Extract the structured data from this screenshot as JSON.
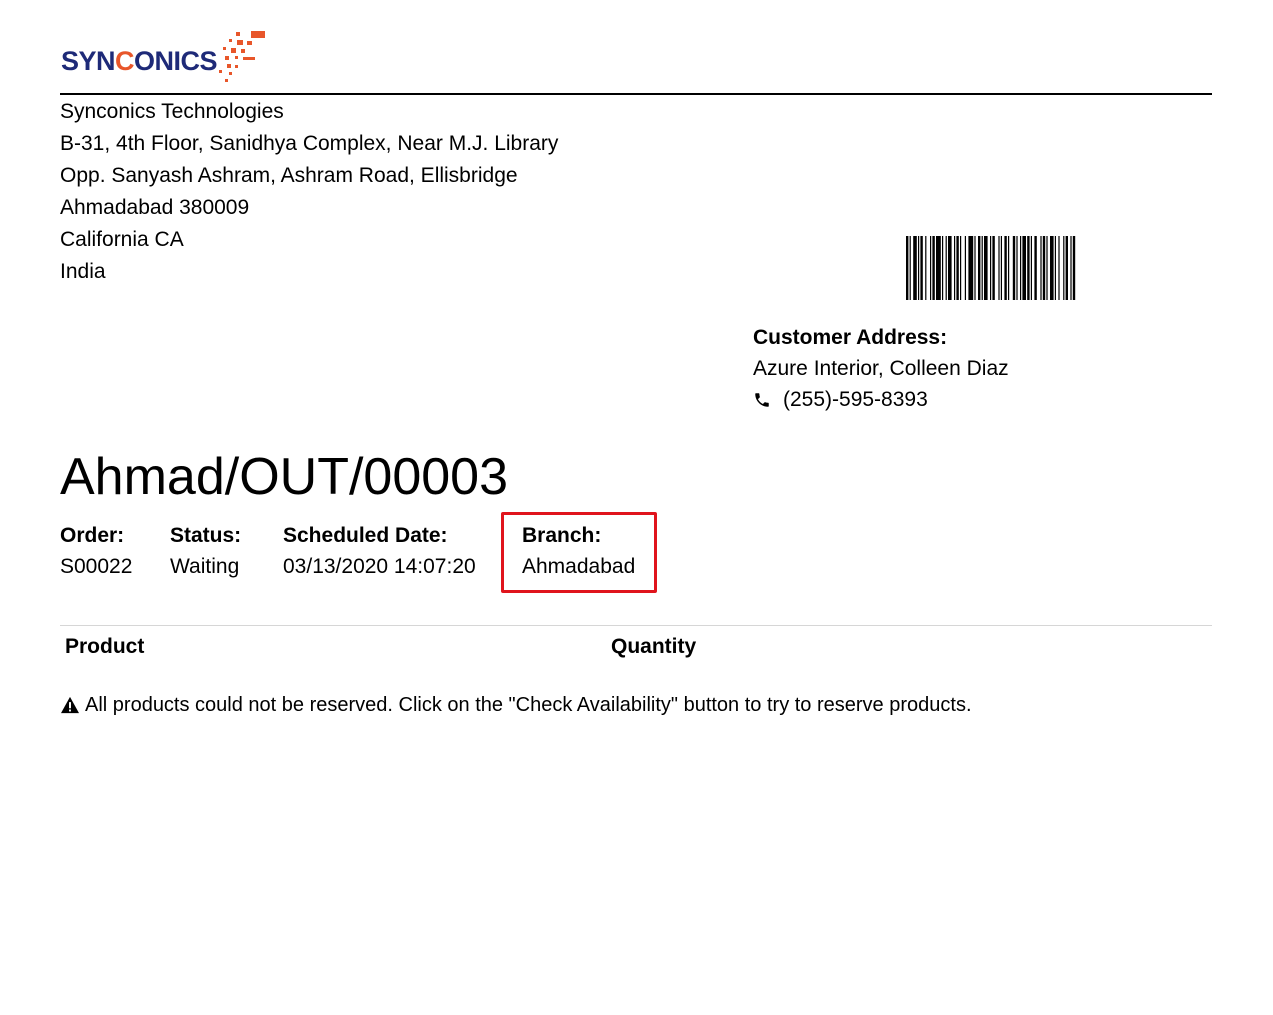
{
  "brand": {
    "logo_part1": "SYN",
    "logo_part2": "C",
    "logo_part3": "ONICS",
    "primary_color": "#1e2a78",
    "accent_color": "#e8562a"
  },
  "company": {
    "lines": [
      "Synconics Technologies",
      "B-31, 4th Floor, Sanidhya Complex, Near M.J. Library",
      "Opp. Sanyash Ashram, Ashram Road, Ellisbridge",
      "Ahmadabad 380009",
      "California CA",
      "India"
    ]
  },
  "customer": {
    "label": "Customer Address:",
    "name": "Azure Interior, Colleen Diaz",
    "phone": "(255)-595-8393",
    "phone_icon": "phone-icon"
  },
  "document": {
    "title": "Ahmad/OUT/00003"
  },
  "info": {
    "order_label": "Order:",
    "order_value": "S00022",
    "status_label": "Status:",
    "status_value": "Waiting",
    "date_label": "Scheduled Date:",
    "date_value": "03/13/2020 14:07:20",
    "branch_label": "Branch:",
    "branch_value": "Ahmadabad",
    "highlight_color": "#e0141c"
  },
  "table": {
    "col_product": "Product",
    "col_quantity": "Quantity"
  },
  "warning": {
    "icon": "warning-icon",
    "text": "All products could not be reserved. Click on the \"Check Availability\" button to try to reserve products."
  }
}
